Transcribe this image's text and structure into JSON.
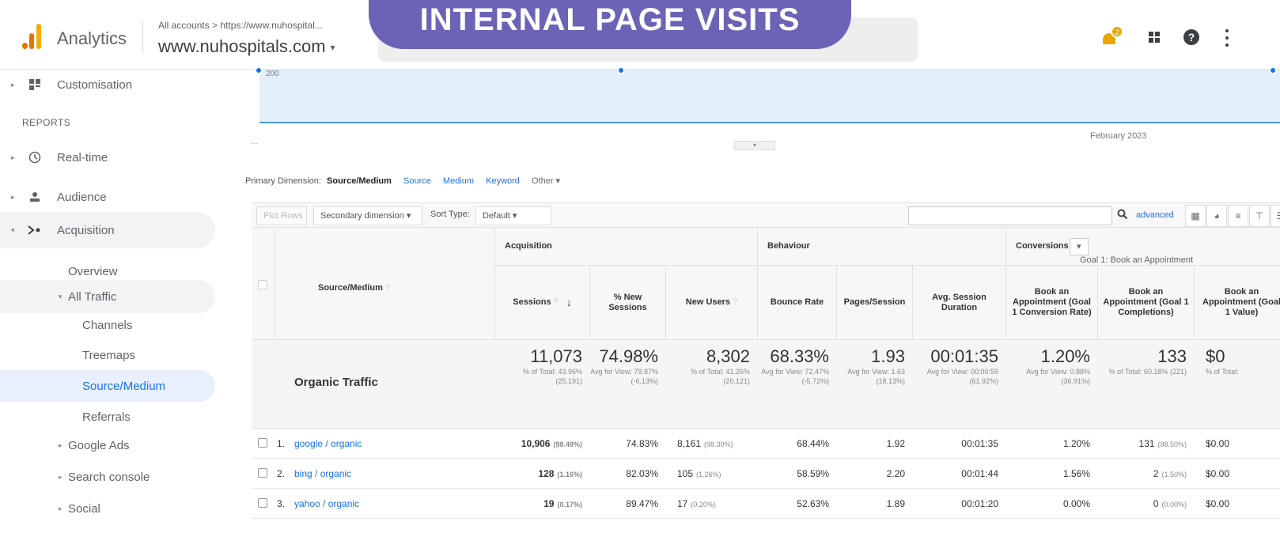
{
  "header": {
    "app_name": "Analytics",
    "breadcrumb": "All accounts > https://www.nuhospital...",
    "property": "www.nuhospitals.com",
    "banner": "INTERNAL PAGE VISITS",
    "notification_count": "2"
  },
  "sidebar": {
    "reports_label": "REPORTS",
    "items": [
      {
        "label": "Customisation"
      },
      {
        "label": "Real-time"
      },
      {
        "label": "Audience"
      },
      {
        "label": "Acquisition"
      },
      {
        "label": "Overview"
      },
      {
        "label": "All Traffic"
      },
      {
        "label": "Channels"
      },
      {
        "label": "Treemaps"
      },
      {
        "label": "Source/Medium"
      },
      {
        "label": "Referrals"
      },
      {
        "label": "Google Ads"
      },
      {
        "label": "Search console"
      },
      {
        "label": "Social"
      }
    ]
  },
  "chart": {
    "y_label": "200",
    "x_label": "February 2023",
    "dots": "..."
  },
  "primary_dimension": {
    "label": "Primary Dimension:",
    "active": "Source/Medium",
    "options": [
      "Source",
      "Medium",
      "Keyword"
    ],
    "other": "Other"
  },
  "toolbar": {
    "plot_rows": "Plot Rows",
    "secondary_dimension": "Secondary dimension",
    "sort_type_label": "Sort Type:",
    "sort_type_value": "Default",
    "advanced": "advanced"
  },
  "table": {
    "groups": {
      "acquisition": "Acquisition",
      "behaviour": "Behaviour",
      "conversions": "Conversions",
      "goal_select": "Goal 1: Book an Appointment"
    },
    "source_header": "Source/Medium",
    "columns": [
      "Sessions",
      "% New Sessions",
      "New Users",
      "Bounce Rate",
      "Pages/Session",
      "Avg. Session Duration",
      "Book an Appointment (Goal 1 Conversion Rate)",
      "Book an Appointment (Goal 1 Completions)",
      "Book an Appointment (Goal 1 Value)"
    ],
    "totals": {
      "label": "Organic Traffic",
      "cells": [
        {
          "big": "11,073",
          "sub": "% of Total: 43.96% (25,191)"
        },
        {
          "big": "74.98%",
          "sub": "Avg for View: 79.87% (-6.13%)"
        },
        {
          "big": "8,302",
          "sub": "% of Total: 41.26% (20,121)"
        },
        {
          "big": "68.33%",
          "sub": "Avg for View: 72.47% (-5.72%)"
        },
        {
          "big": "1.93",
          "sub": "Avg for View: 1.63 (18.13%)"
        },
        {
          "big": "00:01:35",
          "sub": "Avg for View: 00:00:59 (61.92%)"
        },
        {
          "big": "1.20%",
          "sub": "Avg for View: 0.88% (36.91%)"
        },
        {
          "big": "133",
          "sub": "% of Total: 60.18% (221)"
        },
        {
          "big": "$0",
          "sub": "% of Total:"
        }
      ]
    },
    "rows": [
      {
        "num": "1.",
        "source": "google / organic",
        "sessions": "10,906",
        "sessions_pct": "(98.49%)",
        "new_sessions": "74.83%",
        "new_users": "8,161",
        "new_users_pct": "(98.30%)",
        "bounce": "68.44%",
        "pages": "1.92",
        "duration": "00:01:35",
        "conv_rate": "1.20%",
        "completions": "131",
        "completions_pct": "(98.50%)",
        "value": "$0.00"
      },
      {
        "num": "2.",
        "source": "bing / organic",
        "sessions": "128",
        "sessions_pct": "(1.16%)",
        "new_sessions": "82.03%",
        "new_users": "105",
        "new_users_pct": "(1.26%)",
        "bounce": "58.59%",
        "pages": "2.20",
        "duration": "00:01:44",
        "conv_rate": "1.56%",
        "completions": "2",
        "completions_pct": "(1.50%)",
        "value": "$0.00"
      },
      {
        "num": "3.",
        "source": "yahoo / organic",
        "sessions": "19",
        "sessions_pct": "(0.17%)",
        "new_sessions": "89.47%",
        "new_users": "17",
        "new_users_pct": "(0.20%)",
        "bounce": "52.63%",
        "pages": "1.89",
        "duration": "00:01:20",
        "conv_rate": "0.00%",
        "completions": "0",
        "completions_pct": "(0.00%)",
        "value": "$0.00"
      }
    ]
  }
}
